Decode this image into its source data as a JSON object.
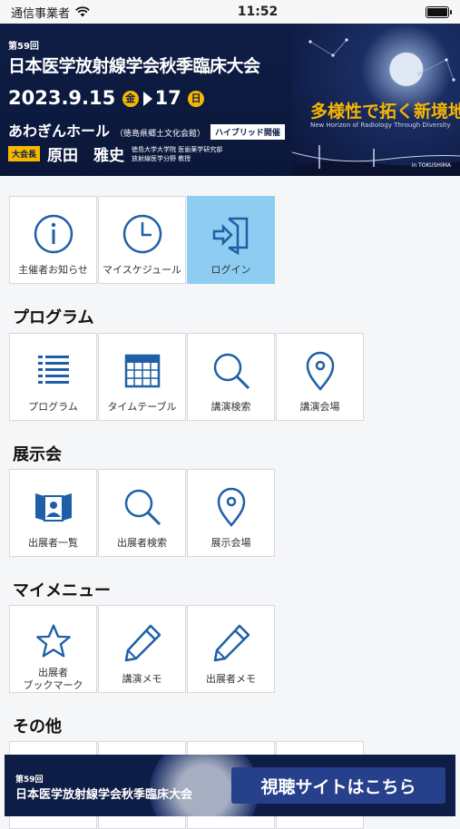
{
  "status": {
    "carrier": "通信事業者",
    "time": "11:52"
  },
  "banner": {
    "edition": "第59回",
    "title": "日本医学放射線学会秋季臨床大会",
    "date_start": "2023.9.15",
    "day_start": "金",
    "date_end": "17",
    "day_end": "日",
    "venue": "あわぎんホール",
    "venue_sub": "（徳島県郷土文化会館）",
    "hybrid": "ハイブリッド開催",
    "chair_tag": "大会長",
    "chair_name": "原田　雅史",
    "chair_aff_1": "徳島大学大学院 医歯薬学研究部",
    "chair_aff_2": "放射線医学分野 教授",
    "slogan": "多様性で拓く新境地",
    "slogan_en": "New Horizon of Radiology Through Diversity",
    "location": "in TOKUSHIMA"
  },
  "top_tiles": [
    {
      "label": "主催者お知らせ",
      "icon": "info-icon"
    },
    {
      "label": "マイスケジュール",
      "icon": "clock-icon"
    },
    {
      "label": "ログイン",
      "icon": "login-icon"
    }
  ],
  "sections": {
    "program": {
      "title": "プログラム",
      "tiles": [
        {
          "label": "プログラム",
          "icon": "list-icon"
        },
        {
          "label": "タイムテーブル",
          "icon": "calendar-icon"
        },
        {
          "label": "講演検索",
          "icon": "search-icon"
        },
        {
          "label": "講演会場",
          "icon": "map-pin-icon"
        }
      ]
    },
    "exhibit": {
      "title": "展示会",
      "tiles": [
        {
          "label": "出展者一覧",
          "icon": "exhibitor-icon"
        },
        {
          "label": "出展者検索",
          "icon": "search-icon"
        },
        {
          "label": "展示会場",
          "icon": "map-pin-icon"
        }
      ]
    },
    "mymenu": {
      "title": "マイメニュー",
      "tiles": [
        {
          "label": "出展者\nブックマーク",
          "icon": "star-icon"
        },
        {
          "label": "講演メモ",
          "icon": "pencil-icon"
        },
        {
          "label": "出展者メモ",
          "icon": "pencil-icon"
        }
      ]
    },
    "other": {
      "title": "その他"
    }
  },
  "footer": {
    "edition": "第59回",
    "title": "日本医学放射線学会秋季臨床大会",
    "button": "視聴サイトはこちら"
  },
  "colors": {
    "navy": "#0e1d45",
    "icon_blue": "#1f5fa8",
    "active_tile": "#8ecdf1",
    "gold": "#f5b700"
  }
}
